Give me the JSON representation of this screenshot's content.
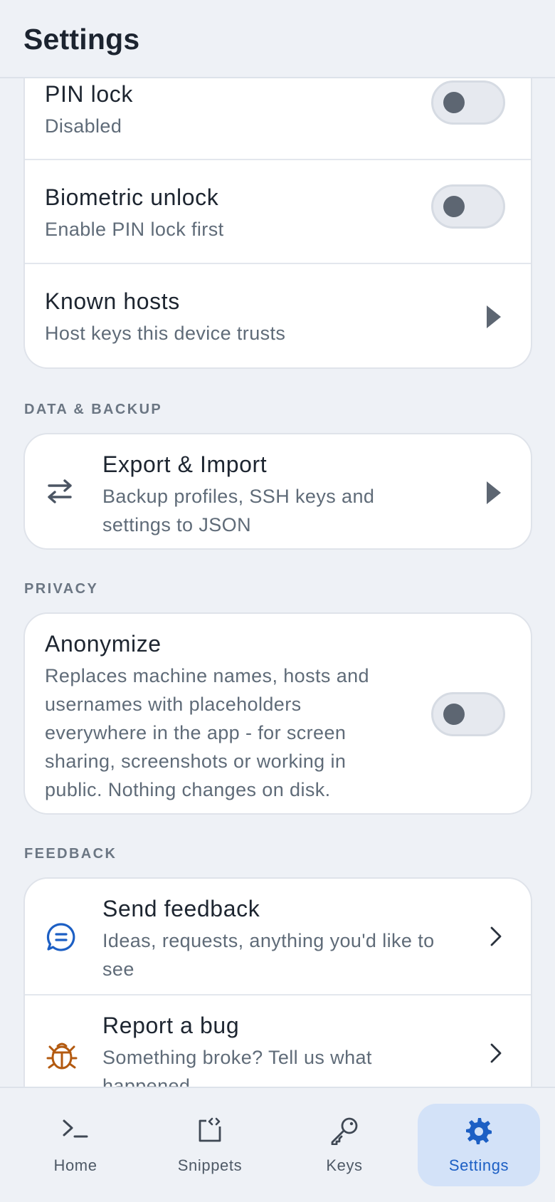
{
  "header": {
    "title": "Settings"
  },
  "security": {
    "pin_lock": {
      "title": "PIN lock",
      "subtitle": "Disabled",
      "enabled": false
    },
    "biometric": {
      "title": "Biometric unlock",
      "subtitle": "Enable PIN lock first",
      "enabled": false
    },
    "known_hosts": {
      "title": "Known hosts",
      "subtitle": "Host keys this device trusts"
    }
  },
  "data_backup": {
    "label": "DATA & BACKUP",
    "export_import": {
      "title": "Export & Import",
      "subtitle_line1": "Backup profiles, SSH keys and",
      "subtitle_line2": "settings to JSON",
      "icon": "swap-arrows-icon"
    }
  },
  "privacy": {
    "label": "PRIVACY",
    "anonymize": {
      "title": "Anonymize",
      "lines": [
        "Replaces machine names, hosts and",
        "usernames with placeholders",
        "everywhere in the app - for screen",
        "sharing, screenshots or working in",
        "public. Nothing changes on disk."
      ],
      "enabled": false
    }
  },
  "feedback": {
    "label": "FEEDBACK",
    "send": {
      "title": "Send feedback",
      "subtitle_line1": "Ideas, requests, anything you'd like to",
      "subtitle_line2": "see",
      "icon": "chat-bubble-icon",
      "icon_color": "#1c5fc4"
    },
    "bug": {
      "title": "Report a bug",
      "subtitle_line1": "Something broke? Tell us what",
      "subtitle_line2": "happened",
      "icon": "bug-icon",
      "icon_color": "#b35a10"
    }
  },
  "tabs": [
    {
      "label": "Home",
      "icon": "terminal-icon",
      "active": false
    },
    {
      "label": "Snippets",
      "icon": "snippet-icon",
      "active": false
    },
    {
      "label": "Keys",
      "icon": "key-icon",
      "active": false
    },
    {
      "label": "Settings",
      "icon": "gear-icon",
      "active": true
    }
  ],
  "colors": {
    "accent": "#1c5fc4",
    "active_tab_bg": "#d3e2f8",
    "background": "#eef1f6"
  }
}
